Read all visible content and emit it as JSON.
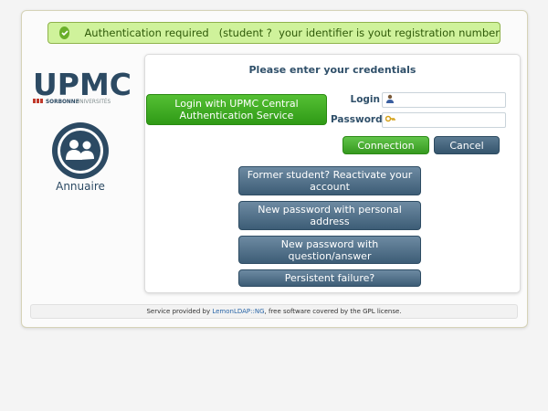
{
  "alert": {
    "message": "Authentication required   (student ?  your identifier is yout registration number"
  },
  "logo": {
    "brand": "UPMC",
    "subtitle_left": "SORBONNE",
    "subtitle_right": "UNIVERSITÉS"
  },
  "annuaire": {
    "label": "Annuaire"
  },
  "panel": {
    "title": "Please enter your credentials"
  },
  "cas": {
    "label": "Login with UPMC Central Authentication Service"
  },
  "form": {
    "login_label": "Login",
    "login_value": "",
    "password_label": "Password",
    "password_value": ""
  },
  "buttons": {
    "connection": "Connection",
    "cancel": "Cancel"
  },
  "actions": [
    {
      "label": "Former student? Reactivate your account"
    },
    {
      "label": "New password with personal address"
    },
    {
      "label": "New password with question/answer"
    },
    {
      "label": "Persistent failure?"
    }
  ],
  "footer": {
    "prefix": "Service provided by ",
    "link": "LemonLDAP::NG",
    "suffix": ", free software covered by the GPL license."
  },
  "colors": {
    "brand_blue": "#2c4a63",
    "brand_red": "#c0392b",
    "green": "#36991f",
    "alert_bg": "#cff29b"
  }
}
